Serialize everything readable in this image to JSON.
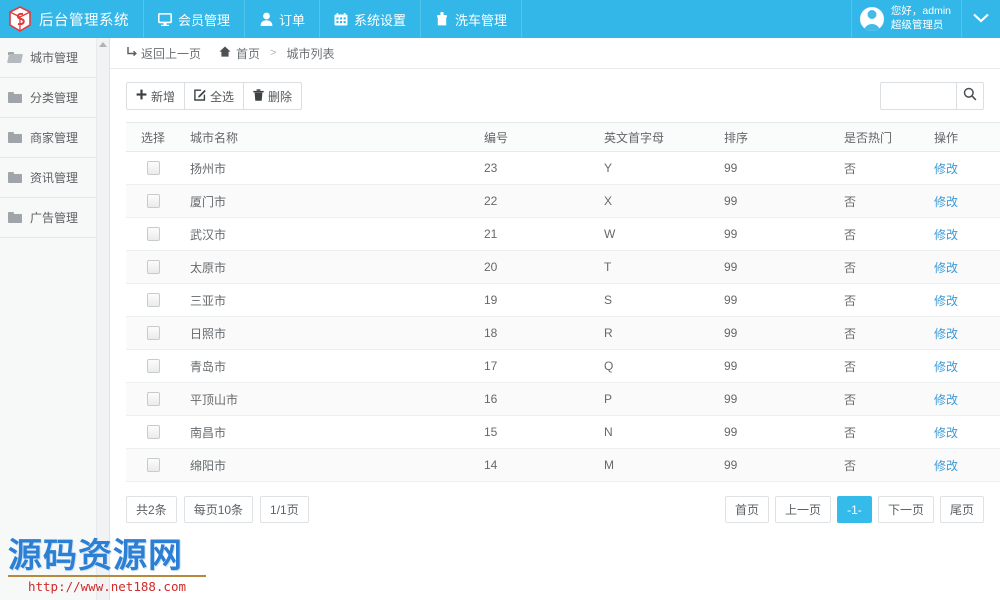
{
  "topbar": {
    "brand": "后台管理系统",
    "nav": [
      {
        "label": "会员管理",
        "icon": "monitor-icon"
      },
      {
        "label": "订单",
        "icon": "user-icon"
      },
      {
        "label": "系统设置",
        "icon": "grid-icon"
      },
      {
        "label": "洗车管理",
        "icon": "puzzle-icon"
      }
    ],
    "user": {
      "greeting": "您好，admin",
      "role": "超级管理员"
    },
    "caret": "⌄",
    "accent_color": "#32b7e8"
  },
  "sidebar": {
    "items": [
      {
        "label": "城市管理",
        "active": true
      },
      {
        "label": "分类管理",
        "active": false
      },
      {
        "label": "商家管理",
        "active": false
      },
      {
        "label": "资讯管理",
        "active": false
      },
      {
        "label": "广告管理",
        "active": false
      }
    ]
  },
  "breadcrumb": {
    "back": "返回上一页",
    "home": "首页",
    "separator": ">",
    "current": "城市列表"
  },
  "toolbar": {
    "add_label": "新增",
    "select_all_label": "全选",
    "delete_label": "删除",
    "add_icon": "plus-icon",
    "select_all_icon": "checkbox-edit-icon",
    "delete_icon": "trash-icon"
  },
  "search": {
    "value": "",
    "placeholder": "",
    "icon": "search-icon"
  },
  "table": {
    "headers": [
      "选择",
      "城市名称",
      "编号",
      "英文首字母",
      "排序",
      "是否热门",
      "操作"
    ],
    "action_label": "修改",
    "rows": [
      {
        "name": "扬州市",
        "num": "23",
        "letter": "Y",
        "sort": "99",
        "hot": "否",
        "action": "修改"
      },
      {
        "name": "厦门市",
        "num": "22",
        "letter": "X",
        "sort": "99",
        "hot": "否",
        "action": "修改"
      },
      {
        "name": "武汉市",
        "num": "21",
        "letter": "W",
        "sort": "99",
        "hot": "否",
        "action": "修改"
      },
      {
        "name": "太原市",
        "num": "20",
        "letter": "T",
        "sort": "99",
        "hot": "否",
        "action": "修改"
      },
      {
        "name": "三亚市",
        "num": "19",
        "letter": "S",
        "sort": "99",
        "hot": "否",
        "action": "修改"
      },
      {
        "name": "日照市",
        "num": "18",
        "letter": "R",
        "sort": "99",
        "hot": "否",
        "action": "修改"
      },
      {
        "name": "青岛市",
        "num": "17",
        "letter": "Q",
        "sort": "99",
        "hot": "否",
        "action": "修改"
      },
      {
        "name": "平顶山市",
        "num": "16",
        "letter": "P",
        "sort": "99",
        "hot": "否",
        "action": "修改"
      },
      {
        "name": "南昌市",
        "num": "15",
        "letter": "N",
        "sort": "99",
        "hot": "否",
        "action": "修改"
      },
      {
        "name": "绵阳市",
        "num": "14",
        "letter": "M",
        "sort": "99",
        "hot": "否",
        "action": "修改"
      }
    ]
  },
  "pagination": {
    "total": "共2条",
    "per_page": "每页10条",
    "page_of": "1/1页",
    "first": "首页",
    "prev": "上一页",
    "current": "-1-",
    "next": "下一页",
    "last": "尾页",
    "active_color": "#35bbe9"
  },
  "watermark": {
    "title": "源码资源网",
    "url": "http://www.net188.com"
  }
}
